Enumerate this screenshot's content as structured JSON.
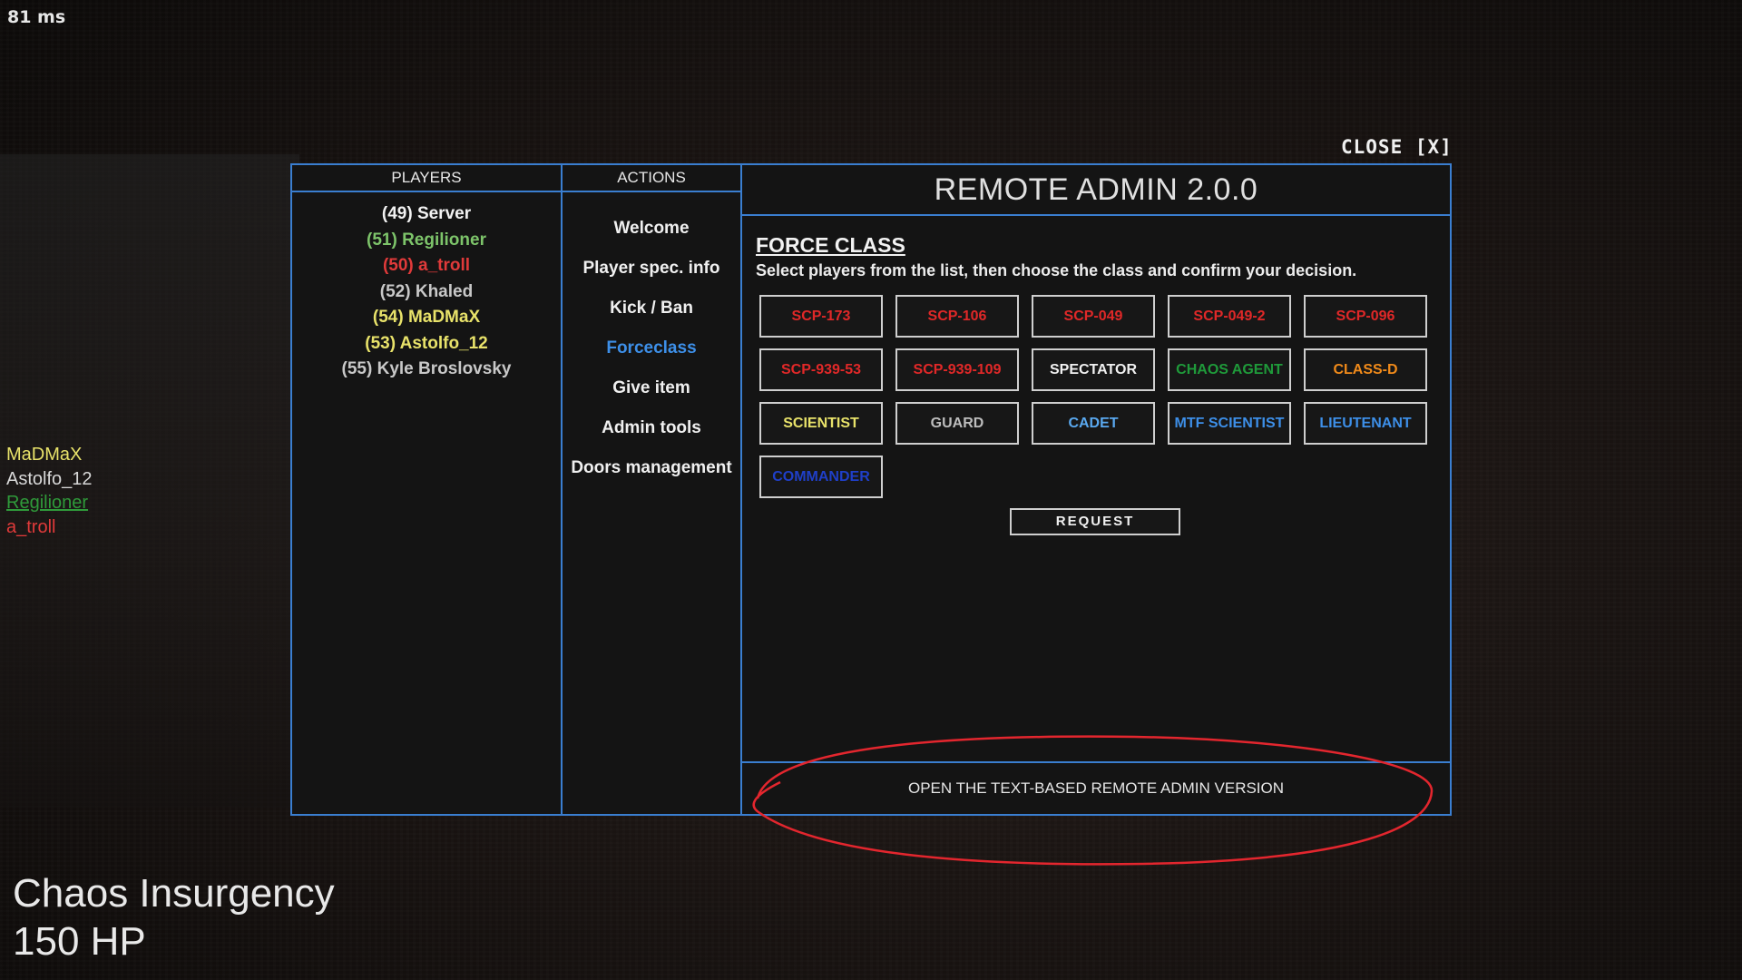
{
  "hud": {
    "ping": "81 ms",
    "team": "Chaos Insurgency",
    "hp": "150 HP"
  },
  "close_label": "CLOSE [X]",
  "players": {
    "header": "PLAYERS",
    "items": [
      {
        "label": "(49) Server",
        "color": "#f2f2f2"
      },
      {
        "label": "(51) Regilioner",
        "color": "#7dc46a"
      },
      {
        "label": "(50) a_troll",
        "color": "#e03a3a"
      },
      {
        "label": "(52) Khaled",
        "color": "#c8c8c8"
      },
      {
        "label": "(54) MaDMaX",
        "color": "#e8e26a"
      },
      {
        "label": "(53) Astolfo_12",
        "color": "#e8e26a"
      },
      {
        "label": "(55) Kyle Broslovsky",
        "color": "#c8c8c8"
      }
    ]
  },
  "actions": {
    "header": "ACTIONS",
    "items": [
      {
        "label": "Welcome",
        "active": false
      },
      {
        "label": "Player spec. info",
        "active": false
      },
      {
        "label": "Kick / Ban",
        "active": false
      },
      {
        "label": "Forceclass",
        "active": true
      },
      {
        "label": "Give item",
        "active": false
      },
      {
        "label": "Admin tools",
        "active": false
      },
      {
        "label": "Doors management",
        "active": false
      }
    ],
    "active_color": "#3d8fe8"
  },
  "main": {
    "title": "REMOTE ADMIN 2.0.0",
    "section_title": "FORCE CLASS",
    "section_desc": "Select players from the list, then choose the class and confirm your decision.",
    "classes": [
      {
        "label": "SCP-173",
        "color": "#e02828"
      },
      {
        "label": "SCP-106",
        "color": "#e02828"
      },
      {
        "label": "SCP-049",
        "color": "#e02828"
      },
      {
        "label": "SCP-049-2",
        "color": "#e02828"
      },
      {
        "label": "SCP-096",
        "color": "#e02828"
      },
      {
        "label": "SCP-939-53",
        "color": "#e02828"
      },
      {
        "label": "SCP-939-109",
        "color": "#e02828"
      },
      {
        "label": "SPECTATOR",
        "color": "#f0f0f0"
      },
      {
        "label": "CHAOS AGENT",
        "color": "#1f9a3a"
      },
      {
        "label": "CLASS-D",
        "color": "#f08a1a"
      },
      {
        "label": "SCIENTIST",
        "color": "#e8e26a"
      },
      {
        "label": "GUARD",
        "color": "#bdbdbd"
      },
      {
        "label": "CADET",
        "color": "#5aa9f0"
      },
      {
        "label": "MTF SCIENTIST",
        "color": "#3d8fe8"
      },
      {
        "label": "LIEUTENANT",
        "color": "#3d8fe8"
      },
      {
        "label": "COMMANDER",
        "color": "#1f3fc8"
      }
    ],
    "request_label": "REQUEST",
    "footer_label": "OPEN THE TEXT-BASED REMOTE ADMIN VERSION"
  },
  "side_list": [
    {
      "label": "MaDMaX",
      "color": "#e8e26a"
    },
    {
      "label": "Astolfo_12",
      "color": "#d8d8d8"
    },
    {
      "label": "Regilioner",
      "color": "#2f9a3a"
    },
    {
      "label": "a_troll",
      "color": "#e03a3a"
    }
  ],
  "colors": {
    "panel_border": "#3a7ed0",
    "annotation": "#e3262e"
  }
}
